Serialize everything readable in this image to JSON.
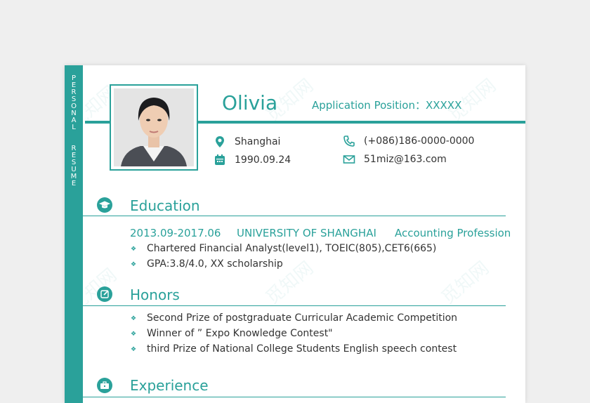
{
  "side_label": {
    "word1": [
      "P",
      "E",
      "R",
      "S",
      "O",
      "N",
      "A",
      "L"
    ],
    "word2": [
      "R",
      "E",
      "S",
      "U",
      "M",
      "E"
    ]
  },
  "header": {
    "name": "Olivia",
    "position": "Application Position：XXXXX"
  },
  "contact": {
    "city": "Shanghai",
    "birthday": "1990.09.24",
    "phone": "(+086)186-0000-0000",
    "email": "51miz@163.com"
  },
  "education": {
    "title": "Education",
    "period": "2013.09-2017.06",
    "school": "UNIVERSITY OF SHANGHAI",
    "major": "Accounting Profession",
    "items": [
      "Chartered Financial Analyst(level1), TOEIC(805),CET6(665)",
      "GPA:3.8/4.0, XX scholarship"
    ]
  },
  "honors": {
    "title": "Honors",
    "items": [
      "Second Prize of postgraduate Curricular Academic Competition",
      "Winner of ”  Expo Knowledge Contest\"",
      "third Prize of National College Students English speech contest"
    ]
  },
  "experience": {
    "title": "Experience"
  },
  "watermark_text": "觅知网",
  "colors": {
    "accent": "#2aa19a",
    "text": "#333333"
  },
  "icons": {
    "location": "location-pin-icon",
    "calendar": "calendar-icon",
    "phone": "phone-icon",
    "email": "envelope-icon",
    "education": "graduation-cap-icon",
    "honors": "edit-icon",
    "experience": "briefcase-icon"
  }
}
